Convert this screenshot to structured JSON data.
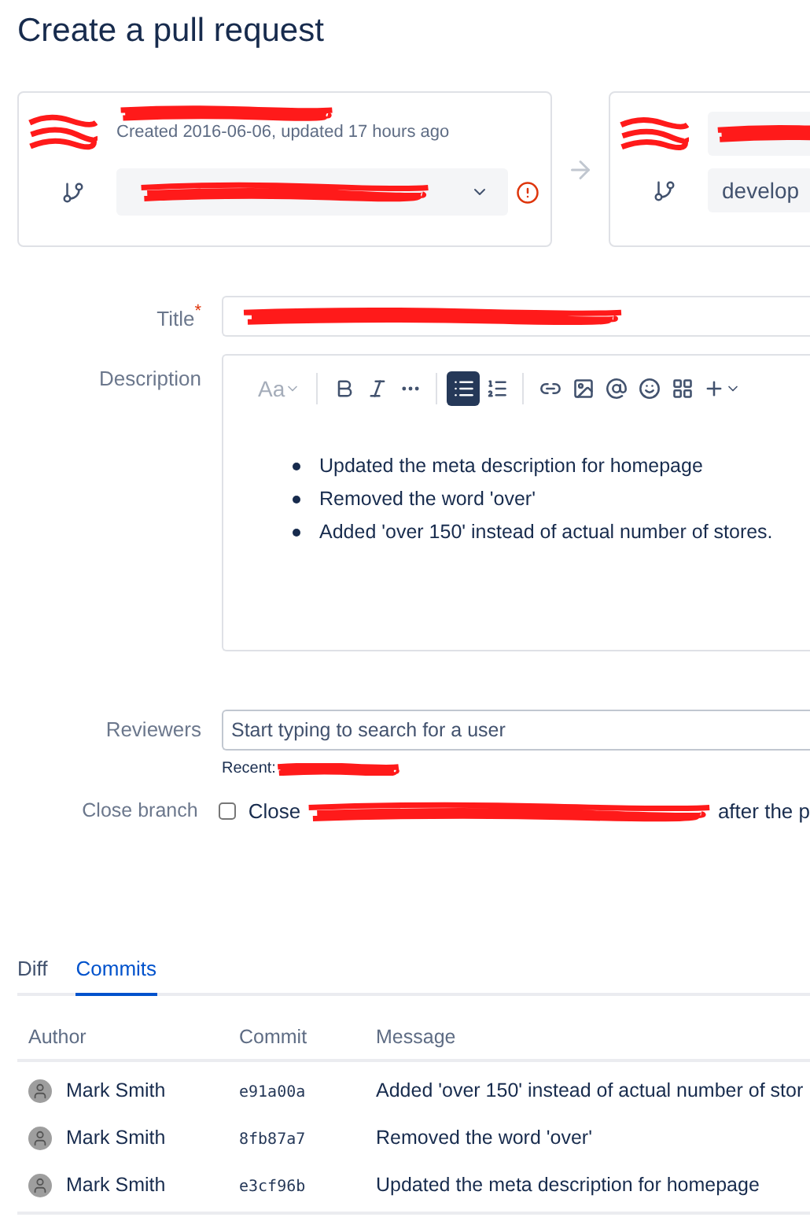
{
  "page_title": "Create a pull request",
  "source": {
    "created": "Created 2016-06-06, updated 17 hours ago"
  },
  "target": {
    "branch": "develop"
  },
  "form": {
    "title_label": "Title",
    "required_mark": "*",
    "description_label": "Description",
    "toolbar": [
      {
        "kind": "text-style",
        "label": "Aa",
        "active": false
      },
      {
        "kind": "divider"
      },
      {
        "kind": "bold",
        "active": false
      },
      {
        "kind": "italic",
        "active": false
      },
      {
        "kind": "more",
        "active": false
      },
      {
        "kind": "divider"
      },
      {
        "kind": "bullet-list",
        "active": true
      },
      {
        "kind": "numbered-list",
        "active": false
      },
      {
        "kind": "divider"
      },
      {
        "kind": "link",
        "active": false
      },
      {
        "kind": "image",
        "active": false
      },
      {
        "kind": "mention",
        "active": false
      },
      {
        "kind": "emoji",
        "active": false
      },
      {
        "kind": "table",
        "active": false
      },
      {
        "kind": "insert",
        "active": false
      }
    ],
    "description_items": [
      "Updated the meta description for homepage",
      "Removed the word 'over'",
      "Added 'over 150' instead of actual number of stores."
    ],
    "reviewers_label": "Reviewers",
    "reviewers_placeholder": "Start typing to search for a user",
    "recent_label": "Recent:",
    "close_branch_label": "Close branch",
    "close_branch_checked": false,
    "close_branch_before": "Close",
    "close_branch_after": "after the p"
  },
  "tabs": [
    {
      "label": "Diff",
      "selected": false
    },
    {
      "label": "Commits",
      "selected": true
    }
  ],
  "commits": {
    "columns": [
      "Author",
      "Commit",
      "Message"
    ],
    "rows": [
      {
        "author": "Mark Smith",
        "commit": "e91a00a",
        "message": "Added 'over 150' instead of actual number of stor"
      },
      {
        "author": "Mark Smith",
        "commit": "8fb87a7",
        "message": "Removed the word 'over'"
      },
      {
        "author": "Mark Smith",
        "commit": "e3cf96b",
        "message": "Updated the meta description for homepage"
      }
    ]
  }
}
